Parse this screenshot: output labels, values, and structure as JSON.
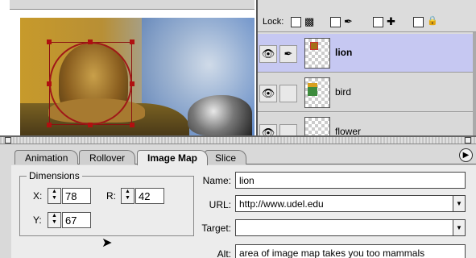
{
  "layers": {
    "lock_label": "Lock:",
    "items": [
      {
        "name": "lion",
        "selected": true
      },
      {
        "name": "bird",
        "selected": false
      },
      {
        "name": "flower",
        "selected": false
      }
    ]
  },
  "tabs": [
    {
      "label": "Animation",
      "active": false
    },
    {
      "label": "Rollover",
      "active": false
    },
    {
      "label": "Image Map",
      "active": true
    },
    {
      "label": "Slice",
      "active": false
    }
  ],
  "dimensions": {
    "legend": "Dimensions",
    "x_label": "X:",
    "x_value": "78",
    "r_label": "R:",
    "r_value": "42",
    "y_label": "Y:",
    "y_value": "67"
  },
  "image_map": {
    "name_label": "Name:",
    "name_value": "lion",
    "url_label": "URL:",
    "url_value": "http://www.udel.edu",
    "target_label": "Target:",
    "target_value": "",
    "alt_label": "Alt:",
    "alt_value": "area of image map takes you too mammals"
  },
  "colors": {
    "selected_layer": "#c6c8f2",
    "hotspot": "#a01818"
  }
}
